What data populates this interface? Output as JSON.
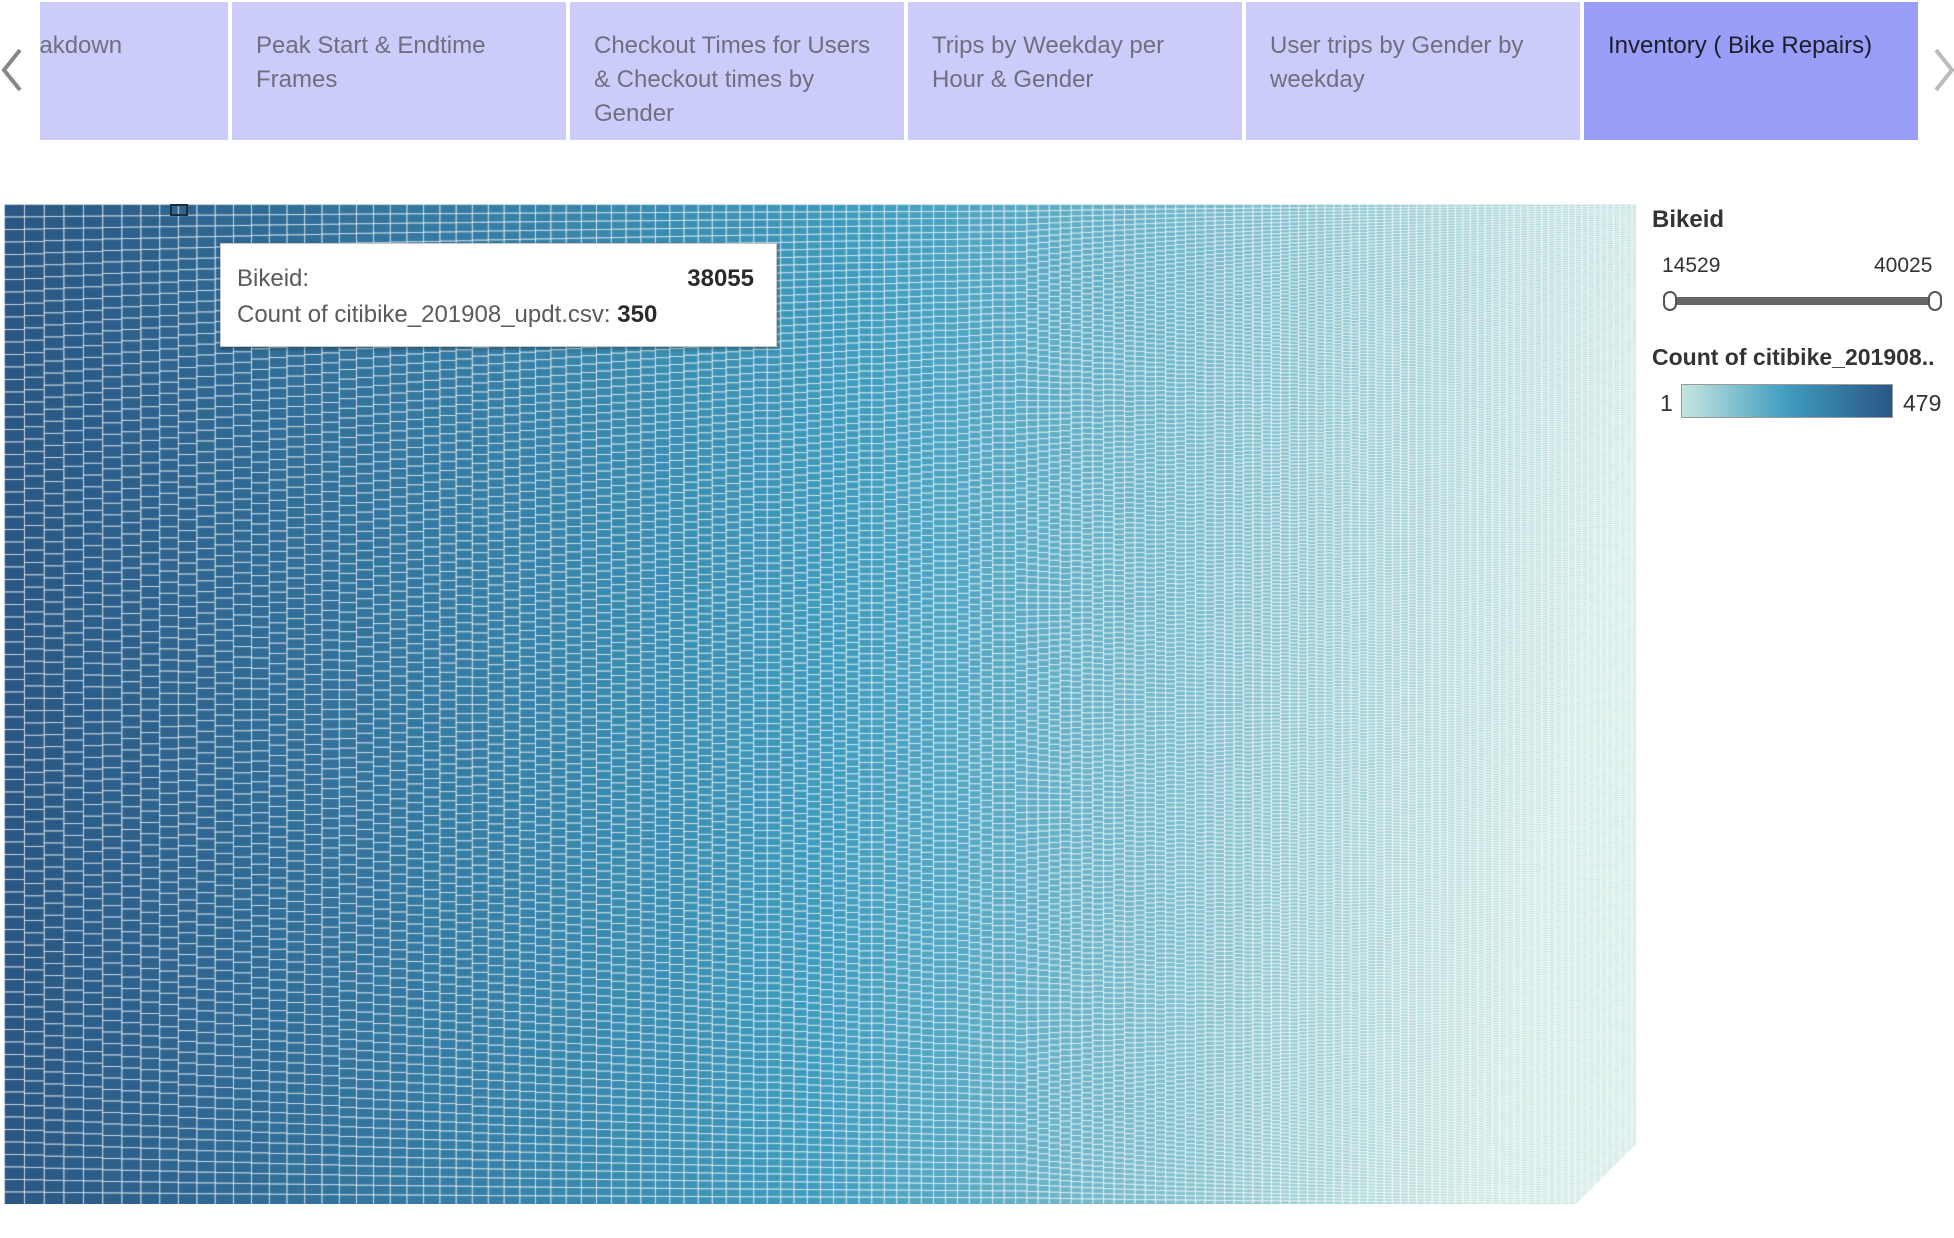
{
  "tabs": [
    {
      "label": "eakdown",
      "active": false
    },
    {
      "label": "Peak Start & Endtime Frames",
      "active": false
    },
    {
      "label": "Checkout Times for Users & Checkout times by Gender",
      "active": false
    },
    {
      "label": "Trips by Weekday per Hour &  Gender",
      "active": false
    },
    {
      "label": "User trips by Gender by weekday",
      "active": false
    },
    {
      "label": "Inventory ( Bike Repairs)",
      "active": true
    }
  ],
  "nav": {
    "prev_icon": "chevron-left-icon",
    "next_icon": "chevron-right-icon"
  },
  "tooltip": {
    "bikeid_label": "Bikeid:",
    "bikeid_value": "38055",
    "count_label": "Count of citibike_201908_updt.csv:",
    "count_value": "350"
  },
  "legend": {
    "bikeid": {
      "title": "Bikeid",
      "min": "14529",
      "max": "40025"
    },
    "count": {
      "title": "Count of citibike_201908..",
      "min": "1",
      "max": "479"
    }
  },
  "colors": {
    "tab_bg": "#ccccfb",
    "tab_active_bg": "#9a9ef8",
    "ramp_low": "#c6e5df",
    "ramp_mid": "#3f9cbf",
    "ramp_high": "#2a5784"
  },
  "chart_data": {
    "type": "heatmap",
    "subtype": "treemap",
    "measure": "Count of citibike_201908_updt.csv",
    "dimension": "Bikeid",
    "color_range": [
      1,
      479
    ],
    "highlighted": {
      "bikeid": 38055,
      "count": 350
    }
  }
}
